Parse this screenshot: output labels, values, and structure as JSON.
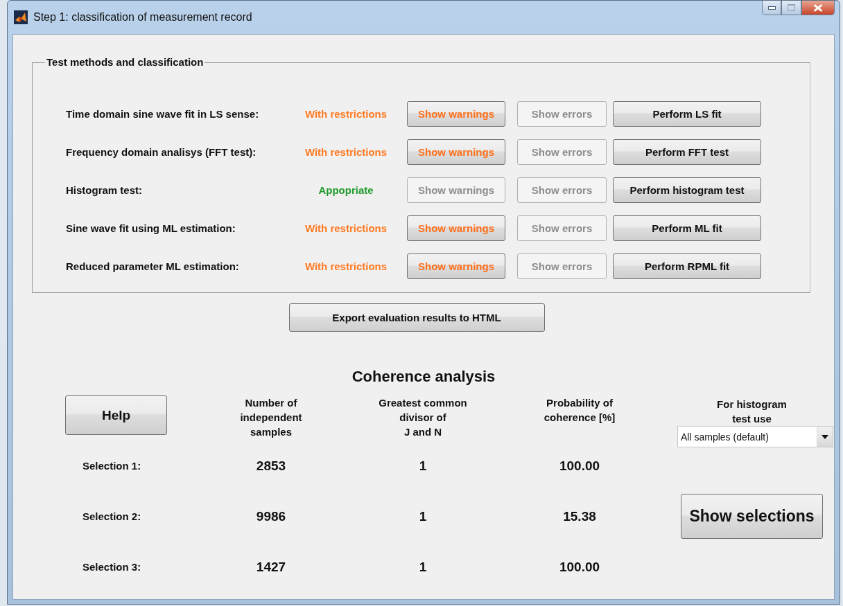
{
  "window": {
    "title": "Step 1: classification of measurement record"
  },
  "test_panel": {
    "title": "Test methods and classification",
    "rows": [
      {
        "label": "Time domain sine wave fit in LS sense:",
        "status": {
          "text": "With restrictions",
          "kind": "restricted"
        },
        "warnings_button": {
          "label": "Show warnings",
          "disabled": false
        },
        "errors_button": {
          "label": "Show errors",
          "disabled": true
        },
        "action_button": {
          "label": "Perform LS fit"
        }
      },
      {
        "label": "Frequency domain analisys (FFT test):",
        "status": {
          "text": "With restrictions",
          "kind": "restricted"
        },
        "warnings_button": {
          "label": "Show warnings",
          "disabled": false
        },
        "errors_button": {
          "label": "Show errors",
          "disabled": true
        },
        "action_button": {
          "label": "Perform FFT test"
        }
      },
      {
        "label": "Histogram test:",
        "status": {
          "text": "Appopriate",
          "kind": "appropriate"
        },
        "warnings_button": {
          "label": "Show warnings",
          "disabled": true
        },
        "errors_button": {
          "label": "Show errors",
          "disabled": true
        },
        "action_button": {
          "label": "Perform histogram test"
        }
      },
      {
        "label": "Sine wave fit using ML estimation:",
        "status": {
          "text": "With restrictions",
          "kind": "restricted"
        },
        "warnings_button": {
          "label": "Show warnings",
          "disabled": false
        },
        "errors_button": {
          "label": "Show errors",
          "disabled": true
        },
        "action_button": {
          "label": "Perform ML fit"
        }
      },
      {
        "label": "Reduced parameter ML estimation:",
        "status": {
          "text": "With restrictions",
          "kind": "restricted"
        },
        "warnings_button": {
          "label": "Show warnings",
          "disabled": false
        },
        "errors_button": {
          "label": "Show errors",
          "disabled": true
        },
        "action_button": {
          "label": "Perform RPML fit"
        }
      }
    ]
  },
  "export_button": {
    "label": "Export evaluation results to HTML"
  },
  "coherence": {
    "title": "Coherence analysis",
    "help_button": {
      "label": "Help"
    },
    "columns": [
      "Number of\nindependent\nsamples",
      "Greatest common\ndivisor of\nJ and N",
      "Probability of\ncoherence [%]"
    ],
    "histogram_use": {
      "label": "For histogram\ntest use",
      "value": "All samples (default)"
    },
    "rows": [
      {
        "label": "Selection 1:",
        "samples": "2853",
        "gcd": "1",
        "probability": "100.00"
      },
      {
        "label": "Selection 2:",
        "samples": "9986",
        "gcd": "1",
        "probability": "15.38"
      },
      {
        "label": "Selection 3:",
        "samples": "1427",
        "gcd": "1",
        "probability": "100.00"
      }
    ],
    "show_selections_button": {
      "label": "Show selections"
    }
  }
}
